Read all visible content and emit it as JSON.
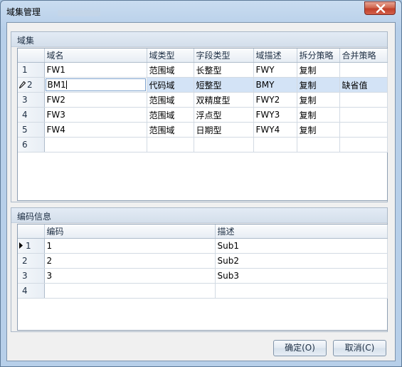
{
  "window": {
    "title": "域集管理"
  },
  "domain_group": {
    "title": "域集",
    "columns": [
      "域名",
      "域类型",
      "字段类型",
      "域描述",
      "拆分策略",
      "合并策略"
    ],
    "rows": [
      {
        "num": "1",
        "name": "FW1",
        "type": "范围域",
        "field_type": "长整型",
        "desc": "FWY",
        "split": "复制",
        "merge": ""
      },
      {
        "num": "2",
        "name": "BM1",
        "type": "代码域",
        "field_type": "短整型",
        "desc": "BMY",
        "split": "复制",
        "merge": "缺省值"
      },
      {
        "num": "3",
        "name": "FW2",
        "type": "范围域",
        "field_type": "双精度型",
        "desc": "FWY2",
        "split": "复制",
        "merge": ""
      },
      {
        "num": "4",
        "name": "FW3",
        "type": "范围域",
        "field_type": "浮点型",
        "desc": "FWY3",
        "split": "复制",
        "merge": ""
      },
      {
        "num": "5",
        "name": "FW4",
        "type": "范围域",
        "field_type": "日期型",
        "desc": "FWY4",
        "split": "复制",
        "merge": ""
      },
      {
        "num": "6",
        "name": "",
        "type": "",
        "field_type": "",
        "desc": "",
        "split": "",
        "merge": ""
      }
    ]
  },
  "code_group": {
    "title": "编码信息",
    "columns": [
      "编码",
      "描述"
    ],
    "rows": [
      {
        "num": "1",
        "code": "1",
        "desc": "Sub1"
      },
      {
        "num": "2",
        "code": "2",
        "desc": "Sub2"
      },
      {
        "num": "3",
        "code": "3",
        "desc": "Sub3"
      },
      {
        "num": "4",
        "code": "",
        "desc": ""
      }
    ]
  },
  "buttons": {
    "ok": "确定(O)",
    "cancel": "取消(C)"
  },
  "icons": {
    "close": "close-icon",
    "edit_row": "pencil-icon",
    "current_row": "row-pointer-icon"
  },
  "colors": {
    "selected_row": "#d3e3f6",
    "close_button": "#c2402a"
  }
}
